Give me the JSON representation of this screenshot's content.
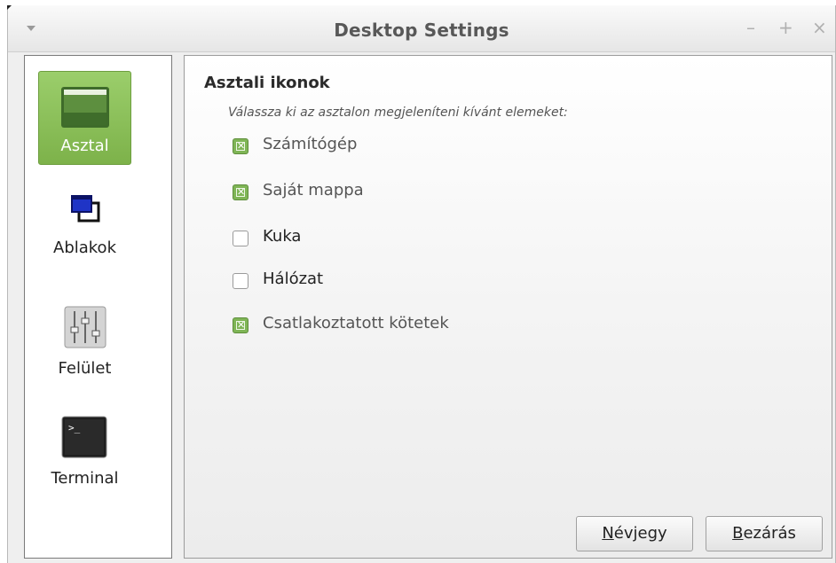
{
  "window": {
    "title": "Desktop Settings",
    "controls": [
      "–",
      "+",
      "×"
    ]
  },
  "sidebar": {
    "items": [
      {
        "label": "Asztal",
        "icon": "desktop-icon",
        "active": true
      },
      {
        "label": "Ablakok",
        "icon": "windows-icon",
        "active": false
      },
      {
        "label": "Felület",
        "icon": "sliders-icon",
        "active": false
      },
      {
        "label": "Terminal",
        "icon": "terminal-icon",
        "active": false
      }
    ]
  },
  "content": {
    "section_title": "Asztali ikonok",
    "subtitle": "Válassza ki az asztalon megjeleníteni kívánt elemeket:",
    "options": [
      {
        "label": "Számítógép",
        "checked": true
      },
      {
        "label": "Saját mappa",
        "checked": true
      },
      {
        "label": "Kuka",
        "checked": false
      },
      {
        "label": "Hálózat",
        "checked": false
      },
      {
        "label": "Csatlakoztatott kötetek",
        "checked": true
      }
    ]
  },
  "buttons": {
    "about": {
      "mnemonic": "N",
      "rest": "évjegy"
    },
    "close": {
      "mnemonic": "B",
      "rest": "ezárás"
    }
  },
  "colors": {
    "accent": "#7fb556",
    "accent_dark": "#5f8f3c"
  }
}
